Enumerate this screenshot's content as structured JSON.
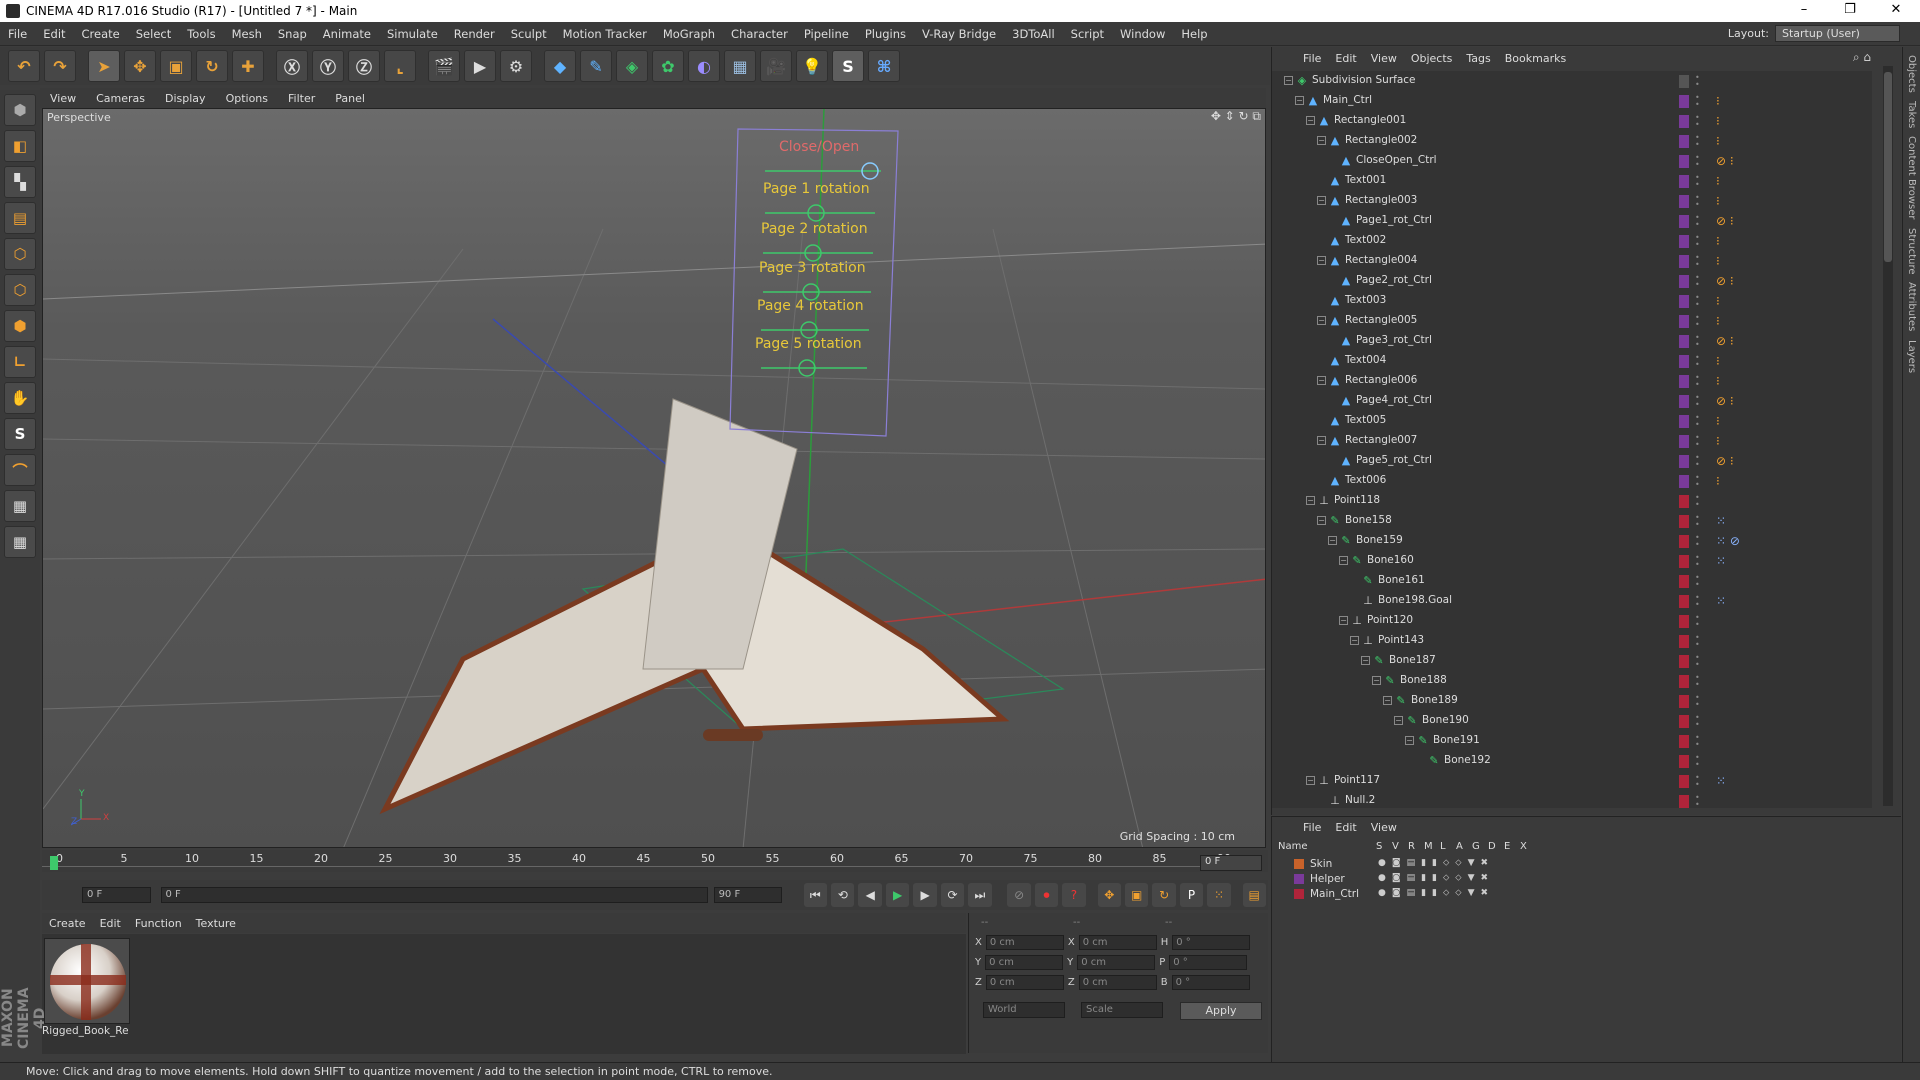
{
  "window": {
    "title": "CINEMA 4D R17.016 Studio (R17) - [Untitled 7 *] - Main",
    "controls": [
      "–",
      "❐",
      "✕"
    ]
  },
  "menubar": [
    "File",
    "Edit",
    "Create",
    "Select",
    "Tools",
    "Mesh",
    "Snap",
    "Animate",
    "Simulate",
    "Render",
    "Sculpt",
    "Motion Tracker",
    "MoGraph",
    "Character",
    "Pipeline",
    "Plugins",
    "V-Ray Bridge",
    "3DToAll",
    "Script",
    "Window",
    "Help"
  ],
  "layout": {
    "label": "Layout:",
    "value": "Startup (User)"
  },
  "toolbar": [
    "undo-icon",
    "redo-icon",
    "select-arrow-icon",
    "move-icon",
    "scale-icon",
    "rotate-icon",
    "move-plus-icon",
    "x-axis-icon",
    "y-axis-icon",
    "z-axis-icon",
    "coordinate-system-icon",
    "render-view-icon",
    "render-picture-viewer-icon",
    "render-settings-icon",
    "cube-primitive-icon",
    "pen-spline-icon",
    "subdivision-icon",
    "array-icon",
    "deformer-icon",
    "floor-icon",
    "camera-icon",
    "light-icon",
    "python-script-icon",
    "python-icon"
  ],
  "viewport": {
    "menu": [
      "View",
      "Cameras",
      "Display",
      "Options",
      "Filter",
      "Panel"
    ],
    "label": "Perspective",
    "grid_spacing": "Grid Spacing : 10 cm",
    "axis": {
      "x": "X",
      "y": "Y",
      "z": "Z"
    },
    "overlay_labels": [
      "Close/Open",
      "Page 1 rotation",
      "Page 2 rotation",
      "Page 3 rotation",
      "Page 4 rotation",
      "Page 5 rotation"
    ]
  },
  "timeline": {
    "ticks": [
      "0",
      "5",
      "10",
      "15",
      "20",
      "25",
      "30",
      "35",
      "40",
      "45",
      "50",
      "55",
      "60",
      "65",
      "70",
      "75",
      "80",
      "85",
      "90"
    ],
    "current_frame": "0 F"
  },
  "transport": {
    "start": "0 F",
    "range_start": "0 F",
    "range_end": "90 F",
    "end": "90 F"
  },
  "material": {
    "menu": [
      "Create",
      "Edit",
      "Function",
      "Texture"
    ],
    "name": "Rigged_Book_Re"
  },
  "coords": {
    "headers": [
      "--",
      "--",
      "--"
    ],
    "rows": [
      [
        "X",
        "0 cm",
        "X",
        "0 cm",
        "H",
        "0 °"
      ],
      [
        "Y",
        "0 cm",
        "Y",
        "0 cm",
        "P",
        "0 °"
      ],
      [
        "Z",
        "0 cm",
        "Z",
        "0 cm",
        "B",
        "0 °"
      ]
    ],
    "mode": "World",
    "scale": "Scale",
    "apply": "Apply"
  },
  "objects": {
    "menu": [
      "File",
      "Edit",
      "View",
      "Objects",
      "Tags",
      "Bookmarks"
    ],
    "rows": [
      {
        "name": "Subdivision Surface",
        "depth": 0,
        "icon": "subdiv",
        "exp": "−"
      },
      {
        "name": "Main_Ctrl",
        "depth": 1,
        "icon": "null",
        "exp": "−"
      },
      {
        "name": "Rectangle001",
        "depth": 2,
        "icon": "spline",
        "exp": "−"
      },
      {
        "name": "Rectangle002",
        "depth": 3,
        "icon": "spline",
        "exp": "−"
      },
      {
        "name": "CloseOpen_Ctrl",
        "depth": 4,
        "icon": "spline",
        "exp": ""
      },
      {
        "name": "Text001",
        "depth": 3,
        "icon": "spline",
        "exp": ""
      },
      {
        "name": "Rectangle003",
        "depth": 3,
        "icon": "spline",
        "exp": "−"
      },
      {
        "name": "Page1_rot_Ctrl",
        "depth": 4,
        "icon": "spline",
        "exp": ""
      },
      {
        "name": "Text002",
        "depth": 3,
        "icon": "spline",
        "exp": ""
      },
      {
        "name": "Rectangle004",
        "depth": 3,
        "icon": "spline",
        "exp": "−"
      },
      {
        "name": "Page2_rot_Ctrl",
        "depth": 4,
        "icon": "spline",
        "exp": ""
      },
      {
        "name": "Text003",
        "depth": 3,
        "icon": "spline",
        "exp": ""
      },
      {
        "name": "Rectangle005",
        "depth": 3,
        "icon": "spline",
        "exp": "−"
      },
      {
        "name": "Page3_rot_Ctrl",
        "depth": 4,
        "icon": "spline",
        "exp": ""
      },
      {
        "name": "Text004",
        "depth": 3,
        "icon": "spline",
        "exp": ""
      },
      {
        "name": "Rectangle006",
        "depth": 3,
        "icon": "spline",
        "exp": "−"
      },
      {
        "name": "Page4_rot_Ctrl",
        "depth": 4,
        "icon": "spline",
        "exp": ""
      },
      {
        "name": "Text005",
        "depth": 3,
        "icon": "spline",
        "exp": ""
      },
      {
        "name": "Rectangle007",
        "depth": 3,
        "icon": "spline",
        "exp": "−"
      },
      {
        "name": "Page5_rot_Ctrl",
        "depth": 4,
        "icon": "spline",
        "exp": ""
      },
      {
        "name": "Text006",
        "depth": 3,
        "icon": "spline",
        "exp": ""
      },
      {
        "name": "Point118",
        "depth": 2,
        "icon": "point",
        "exp": "−"
      },
      {
        "name": "Bone158",
        "depth": 3,
        "icon": "bone",
        "exp": "−"
      },
      {
        "name": "Bone159",
        "depth": 4,
        "icon": "bone",
        "exp": "−"
      },
      {
        "name": "Bone160",
        "depth": 5,
        "icon": "bone",
        "exp": "−"
      },
      {
        "name": "Bone161",
        "depth": 6,
        "icon": "bone",
        "exp": ""
      },
      {
        "name": "Bone198.Goal",
        "depth": 6,
        "icon": "point",
        "exp": ""
      },
      {
        "name": "Point120",
        "depth": 5,
        "icon": "point",
        "exp": "−"
      },
      {
        "name": "Point143",
        "depth": 6,
        "icon": "point",
        "exp": "−"
      },
      {
        "name": "Bone187",
        "depth": 7,
        "icon": "bone",
        "exp": "−"
      },
      {
        "name": "Bone188",
        "depth": 8,
        "icon": "bone",
        "exp": "−"
      },
      {
        "name": "Bone189",
        "depth": 9,
        "icon": "bone",
        "exp": "−"
      },
      {
        "name": "Bone190",
        "depth": 10,
        "icon": "bone",
        "exp": "−"
      },
      {
        "name": "Bone191",
        "depth": 11,
        "icon": "bone",
        "exp": "−"
      },
      {
        "name": "Bone192",
        "depth": 12,
        "icon": "bone",
        "exp": ""
      },
      {
        "name": "Point117",
        "depth": 2,
        "icon": "point",
        "exp": "−"
      },
      {
        "name": "Null.2",
        "depth": 3,
        "icon": "point",
        "exp": ""
      }
    ]
  },
  "side_tabs": [
    "Objects",
    "Takes",
    "Content Browser",
    "Structure",
    "Attributes",
    "Layers"
  ],
  "layers": {
    "menu": [
      "File",
      "Edit",
      "View"
    ],
    "headers": [
      "Name",
      "S",
      "V",
      "R",
      "M",
      "L",
      "A",
      "G",
      "D",
      "E",
      "X"
    ],
    "rows": [
      {
        "name": "Skin",
        "color": "#c8622a"
      },
      {
        "name": "Helper",
        "color": "#7a3a9a"
      },
      {
        "name": "Main_Ctrl",
        "color": "#b0243a"
      }
    ]
  },
  "status": "Move: Click and drag to move elements. Hold down SHIFT to quantize movement / add to the selection in point mode, CTRL to remove.",
  "brand": "MAXON CINEMA 4D"
}
